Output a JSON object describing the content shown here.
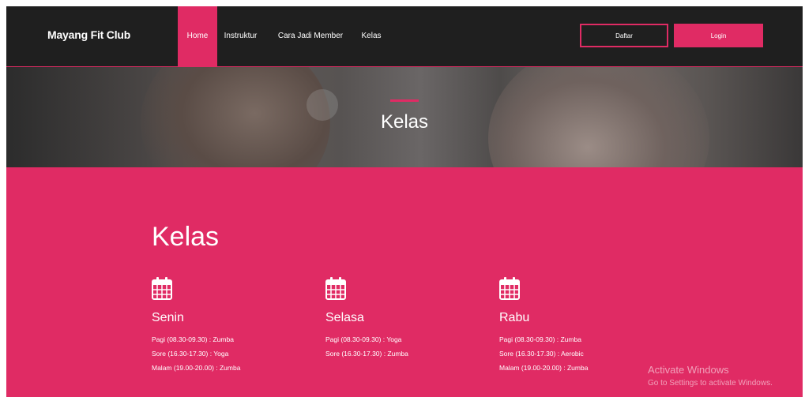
{
  "navbar": {
    "brand": "Mayang Fit Club",
    "links": [
      {
        "label": "Home",
        "active": true
      },
      {
        "label": "Instruktur"
      },
      {
        "label": "Cara Jadi Member"
      },
      {
        "label": "Kelas"
      }
    ],
    "daftar_label": "Daftar",
    "login_label": "Login"
  },
  "hero": {
    "title": "Kelas"
  },
  "section": {
    "title": "Kelas",
    "days": [
      {
        "name": "Senin",
        "icon": "calendar-icon",
        "schedule": [
          "Pagi (08.30-09.30) : Zumba",
          "Sore (16.30-17.30) : Yoga",
          "Malam (19.00-20.00) : Zumba"
        ]
      },
      {
        "name": "Selasa",
        "icon": "calendar-icon",
        "schedule": [
          "Pagi (08.30-09.30) : Yoga",
          "Sore (16.30-17.30) : Zumba"
        ]
      },
      {
        "name": "Rabu",
        "icon": "calendar-icon",
        "schedule": [
          "Pagi (08.30-09.30) : Zumba",
          "Sore (16.30-17.30) : Aerobic",
          "Malam (19.00-20.00) : Zumba"
        ]
      }
    ]
  },
  "watermark": {
    "title": "Activate Windows",
    "subtitle": "Go to Settings to activate Windows."
  },
  "colors": {
    "accent": "#e02b64",
    "navbar": "#1f1f1f"
  }
}
